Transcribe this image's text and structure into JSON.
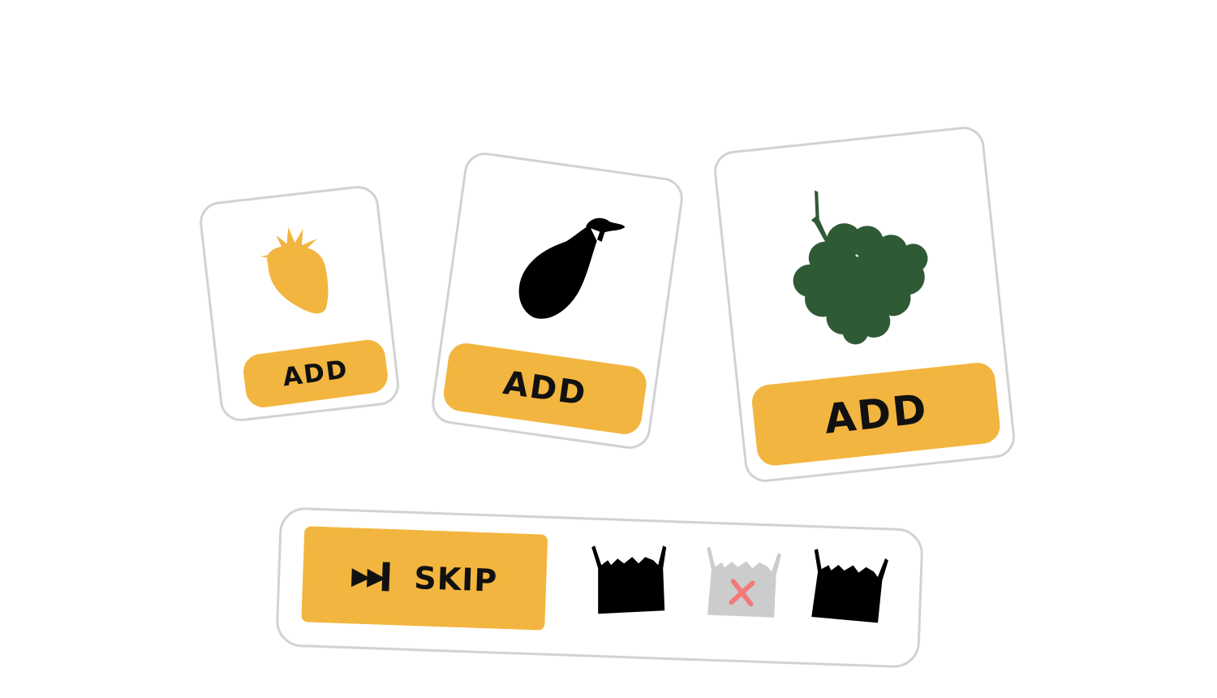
{
  "cards": [
    {
      "fruit": "strawberry",
      "icon": "strawberry-icon",
      "color": "#f2b53f",
      "button_label": "ADD"
    },
    {
      "fruit": "eggplant",
      "icon": "eggplant-icon",
      "color": "#000000",
      "button_label": "ADD"
    },
    {
      "fruit": "grapes",
      "icon": "grapes-icon",
      "color": "#2f5a36",
      "button_label": "ADD"
    }
  ],
  "tray": {
    "skip_label": "SKIP",
    "skip_icon": "fast-forward-icon",
    "slots": [
      {
        "state": "filled",
        "icon": "basket-icon",
        "color": "#000000"
      },
      {
        "state": "empty-crossed",
        "icon": "basket-crossed-icon",
        "color": "#cccccc",
        "mark_color": "#f37a7a"
      },
      {
        "state": "filled",
        "icon": "basket-icon",
        "color": "#000000"
      }
    ]
  },
  "colors": {
    "accent": "#f2b53f",
    "border": "#d2d2d2"
  }
}
